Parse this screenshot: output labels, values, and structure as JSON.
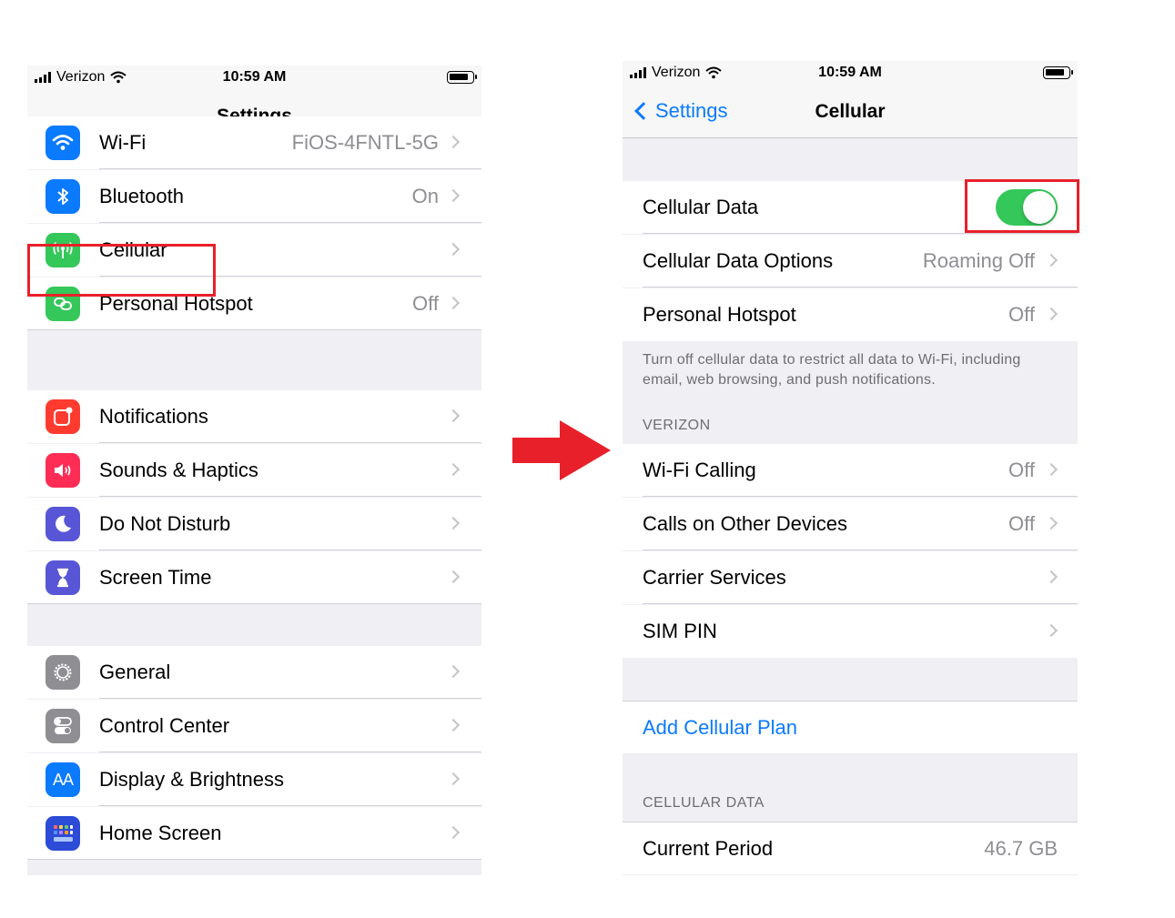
{
  "left": {
    "status": {
      "carrier": "Verizon",
      "time": "10:59 AM"
    },
    "title": "Settings",
    "groups": [
      [
        {
          "label": "Wi-Fi",
          "value": "FiOS-4FNTL-5G",
          "icon": "wifi-icon",
          "color": "#0a7aff"
        },
        {
          "label": "Bluetooth",
          "value": "On",
          "icon": "bluetooth-icon",
          "color": "#0a7aff"
        },
        {
          "label": "Cellular",
          "value": "",
          "icon": "antenna-icon",
          "color": "#34c759"
        },
        {
          "label": "Personal Hotspot",
          "value": "Off",
          "icon": "hotspot-link-icon",
          "color": "#34c759"
        }
      ],
      [
        {
          "label": "Notifications",
          "value": "",
          "icon": "notifications-icon",
          "color": "#ff3b30"
        },
        {
          "label": "Sounds & Haptics",
          "value": "",
          "icon": "speaker-icon",
          "color": "#ff2d55"
        },
        {
          "label": "Do Not Disturb",
          "value": "",
          "icon": "moon-icon",
          "color": "#5856d6"
        },
        {
          "label": "Screen Time",
          "value": "",
          "icon": "hourglass-icon",
          "color": "#5856d6"
        }
      ],
      [
        {
          "label": "General",
          "value": "",
          "icon": "gear-icon",
          "color": "#8e8e93"
        },
        {
          "label": "Control Center",
          "value": "",
          "icon": "toggles-icon",
          "color": "#8e8e93"
        },
        {
          "label": "Display & Brightness",
          "value": "",
          "icon": "text-size-icon",
          "color": "#0a7aff",
          "glyph": "AA"
        },
        {
          "label": "Home Screen",
          "value": "",
          "icon": "app-grid-icon",
          "color": "#2c4bd6"
        }
      ]
    ]
  },
  "right": {
    "status": {
      "carrier": "Verizon",
      "time": "10:59 AM"
    },
    "back_label": "Settings",
    "title": "Cellular",
    "main_rows": [
      {
        "label": "Cellular Data",
        "toggle": true
      },
      {
        "label": "Cellular Data Options",
        "value": "Roaming Off"
      },
      {
        "label": "Personal Hotspot",
        "value": "Off"
      }
    ],
    "note": "Turn off cellular data to restrict all data to Wi-Fi, including email, web browsing, and push notifications.",
    "verizon_header": "VERIZON",
    "verizon_rows": [
      {
        "label": "Wi-Fi Calling",
        "value": "Off"
      },
      {
        "label": "Calls on Other Devices",
        "value": "Off"
      },
      {
        "label": "Carrier Services",
        "value": ""
      },
      {
        "label": "SIM PIN",
        "value": ""
      }
    ],
    "add_plan": "Add Cellular Plan",
    "data_header": "CELLULAR DATA",
    "period_row": {
      "label": "Current Period",
      "value": "46.7 GB"
    }
  },
  "colors": {
    "highlight": "#e8202a",
    "arrow": "#e8202a",
    "link": "#0a7aff",
    "toggle_on": "#34c759"
  }
}
